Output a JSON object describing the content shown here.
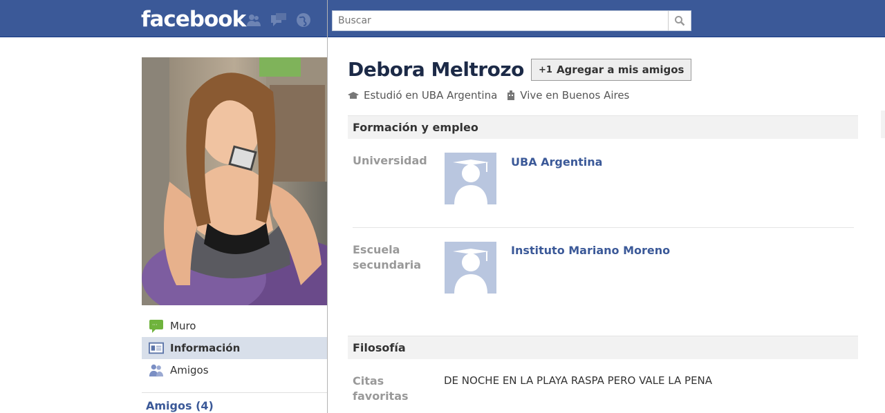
{
  "header": {
    "logo": "facebook",
    "search_placeholder": "Buscar",
    "jewels": [
      "friends-icon",
      "messages-icon",
      "notifications-icon"
    ]
  },
  "profile": {
    "name": "Debora Meltrozo",
    "add_friend_label": "Agregar a mis amigos",
    "studied": "Estudió en UBA Argentina",
    "lives": "Vive en Buenos Aires"
  },
  "nav": {
    "items": [
      {
        "label": "Muro",
        "icon": "wall-icon"
      },
      {
        "label": "Información",
        "icon": "info-icon"
      },
      {
        "label": "Amigos",
        "icon": "friends-icon"
      }
    ],
    "friends_heading": "Amigos (4)"
  },
  "sections": {
    "education": {
      "title": "Formación y empleo",
      "university_label": "Universidad",
      "university_name": "UBA Argentina",
      "highschool_label_1": "Escuela",
      "highschool_label_2": "secundaria",
      "highschool_name": "Instituto Mariano Moreno"
    },
    "philosophy": {
      "title": "Filosofía",
      "quotes_label_1": "Citas",
      "quotes_label_2": "favoritas",
      "quotes": "DE NOCHE EN LA PLAYA RASPA PERO VALE LA PENA"
    }
  },
  "colors": {
    "brand": "#3b5998",
    "nav_active": "#d8dfea",
    "section_bg": "#f2f2f2"
  }
}
